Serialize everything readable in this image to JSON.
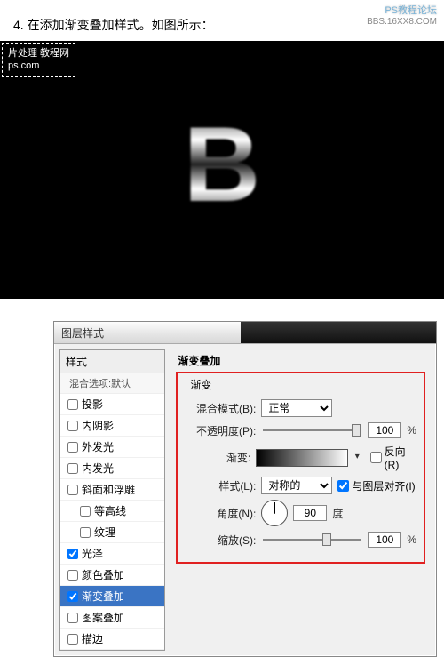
{
  "brand": {
    "line1": "PS教程论坛",
    "line2": "BBS.16XX8.COM"
  },
  "step_text": "4. 在添加渐变叠加样式。如图所示：",
  "watermark": {
    "line1": "片处理 教程网",
    "line2": "ps.com"
  },
  "preview_letter": "B",
  "dialog": {
    "title": "图层样式",
    "styles_header": "样式",
    "blend_default": "混合选项:默认",
    "items": [
      {
        "label": "投影",
        "checked": false,
        "indent": false
      },
      {
        "label": "内阴影",
        "checked": false,
        "indent": false
      },
      {
        "label": "外发光",
        "checked": false,
        "indent": false
      },
      {
        "label": "内发光",
        "checked": false,
        "indent": false
      },
      {
        "label": "斜面和浮雕",
        "checked": false,
        "indent": false
      },
      {
        "label": "等高线",
        "checked": false,
        "indent": true
      },
      {
        "label": "纹理",
        "checked": false,
        "indent": true
      },
      {
        "label": "光泽",
        "checked": true,
        "indent": false
      },
      {
        "label": "颜色叠加",
        "checked": false,
        "indent": false
      },
      {
        "label": "渐变叠加",
        "checked": true,
        "indent": false,
        "selected": true
      },
      {
        "label": "图案叠加",
        "checked": false,
        "indent": false
      },
      {
        "label": "描边",
        "checked": false,
        "indent": false
      }
    ],
    "right": {
      "section_title": "渐变叠加",
      "group_title": "渐变",
      "blend_mode_label": "混合模式(B):",
      "blend_mode_value": "正常",
      "opacity_label": "不透明度(P):",
      "opacity_value": "100",
      "opacity_unit": "%",
      "gradient_label": "渐变:",
      "reverse_label": "反向(R)",
      "reverse_checked": false,
      "style_label": "样式(L):",
      "style_value": "对称的",
      "align_label": "与图层对齐(I)",
      "align_checked": true,
      "angle_label": "角度(N):",
      "angle_value": "90",
      "angle_unit": "度",
      "scale_label": "缩放(S):",
      "scale_value": "100",
      "scale_unit": "%"
    }
  }
}
